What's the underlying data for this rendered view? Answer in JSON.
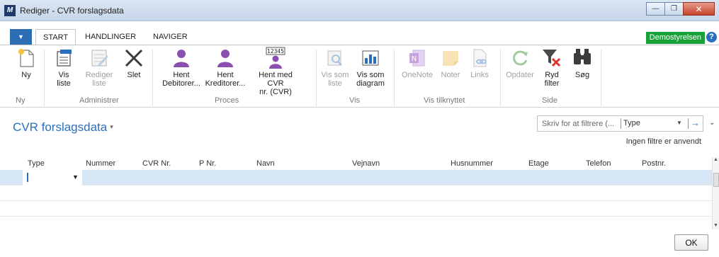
{
  "window": {
    "title": "Rediger - CVR forslagsdata",
    "logo_text": "M",
    "minimize": "—",
    "restore": "❐",
    "close": "✕"
  },
  "ribbon_tabs": [
    {
      "label": "START",
      "active": true
    },
    {
      "label": "HANDLINGER",
      "active": false
    },
    {
      "label": "NAVIGER",
      "active": false
    }
  ],
  "app_menu_glyph": "▼",
  "company": "Demostyrelsen",
  "help": "?",
  "ribbon": {
    "ny": {
      "label": "Ny",
      "group": "Ny"
    },
    "administrer": {
      "group": "Administrer",
      "vis_liste": [
        "Vis",
        "liste"
      ],
      "rediger_liste": [
        "Rediger",
        "liste"
      ],
      "slet": "Slet"
    },
    "proces": {
      "group": "Proces",
      "hent_debitorer": [
        "Hent",
        "Debitorer..."
      ],
      "hent_kreditorer": [
        "Hent",
        "Kreditorer..."
      ],
      "hent_cvr": [
        "Hent med CVR",
        "nr. (CVR)"
      ],
      "cvr_icon_text": "12345"
    },
    "vis": {
      "group": "Vis",
      "vis_som_liste": [
        "Vis som",
        "liste"
      ],
      "vis_som_diagram": [
        "Vis som",
        "diagram"
      ]
    },
    "vis_tilknyttet": {
      "group": "Vis tilknyttet",
      "onenote": "OneNote",
      "noter": "Noter",
      "links": "Links"
    },
    "side": {
      "group": "Side",
      "opdater": "Opdater",
      "ryd_filter": [
        "Ryd",
        "filter"
      ],
      "sog": "Søg"
    }
  },
  "page": {
    "title": "CVR forslagsdata",
    "title_caret": "▾",
    "filter_placeholder": "Skriv for at filtrere (...",
    "filter_field": "Type",
    "filter_dd": "▼",
    "filter_go": "→",
    "collapse": "⌄",
    "no_filter": "Ingen filtre er anvendt"
  },
  "grid": {
    "columns": [
      "Type",
      "Nummer",
      "CVR Nr.",
      "P Nr.",
      "Navn",
      "Vejnavn",
      "Husnummer",
      "Etage",
      "Telefon",
      "Postnr."
    ],
    "type_dd": "▼"
  },
  "ok_label": "OK",
  "colors": {
    "accent": "#2a6fbf",
    "company_badge": "#18a33a",
    "selected_row": "#d6e6f5",
    "purple_icon": "#8b4fb0"
  }
}
